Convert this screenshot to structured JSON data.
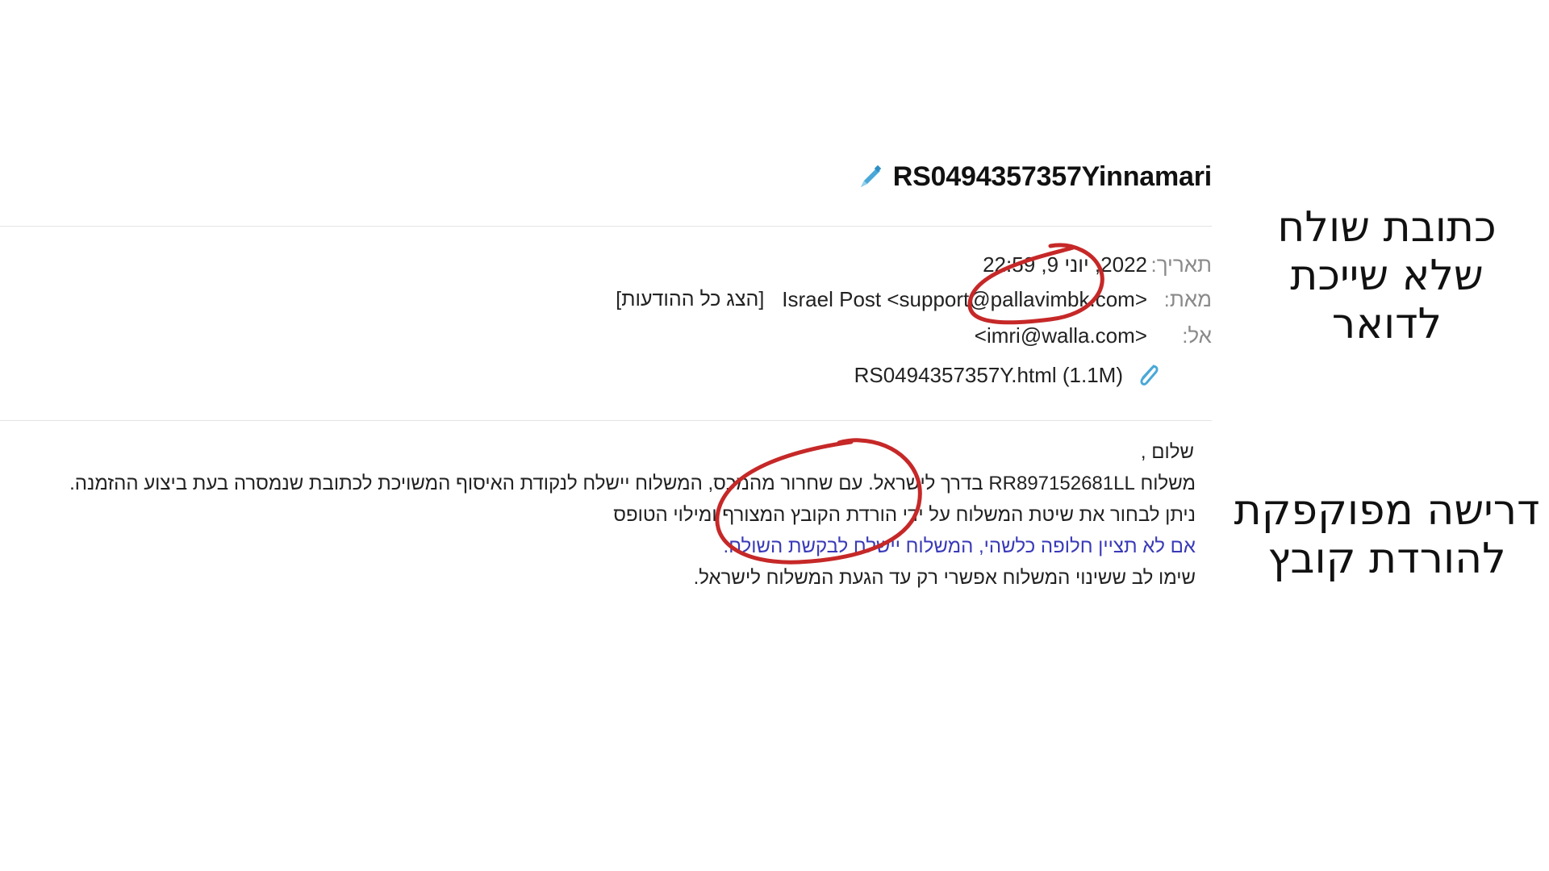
{
  "email": {
    "subject": "RS0494357357Yinnamari",
    "headers": {
      "date_label": "תאריך:",
      "date_value": "2022, יוני 9, 22:59",
      "from_label": "מאת:",
      "from_value": "Israel Post <support@pallavimbk.com>",
      "show_all_label": "[הצג כל ההודעות]",
      "to_label": "אל:",
      "to_value": "<imri@walla.com>"
    },
    "attachment": {
      "name": "RS0494357357Y.html (1.1M)",
      "icon": "paperclip-icon"
    },
    "body": {
      "greeting": "שלום ,",
      "line1": "משלוח RR897152681LL בדרך לישראל. עם שחרור מהמכס, המשלוח יישלח לנקודת האיסוף המשויכת לכתובת שנמסרה בעת ביצוע ההזמנה.",
      "line2": "ניתן לבחור את שיטת המשלוח על ידי הורדת הקובץ המצורף ומילוי הטופס",
      "line3": "אם לא תציין חלופה כלשהי, המשלוח יישלח לבקשת השולח.",
      "line4": "שימו לב ששינוי המשלוח אפשרי רק עד הגעת המשלוח לישראל."
    }
  },
  "annotations": {
    "sender_note": "כתובת שולח שלא שייכת לדואר",
    "download_note": "דרישה מפוקפקת להורדת קובץ",
    "circle_color": "#c62828"
  },
  "colors": {
    "link_blue": "#3a3ab8",
    "icon_blue": "#4aa8d8",
    "label_gray": "#8a8a8a"
  }
}
